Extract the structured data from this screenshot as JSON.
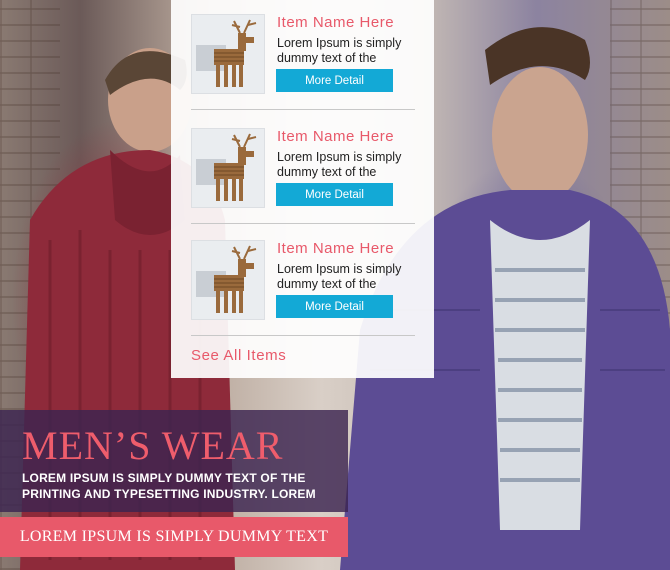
{
  "menu": {
    "items": [
      {
        "name": "Item Name Here",
        "description": "Lorem Ipsum is simply dummy text of the",
        "button": "More Detail",
        "image": "wooden-reindeer-image"
      },
      {
        "name": "Item Name Here",
        "description": "Lorem Ipsum is simply dummy text of the",
        "button": "More Detail",
        "image": "wooden-reindeer-image"
      },
      {
        "name": "Item Name Here",
        "description": "Lorem Ipsum is simply dummy text of the",
        "button": "More Detail",
        "image": "wooden-reindeer-image"
      }
    ],
    "see_all": "See All Items"
  },
  "banner": {
    "title": "MEN’S WEAR",
    "subtitle": "LOREM IPSUM IS SIMPLY DUMMY TEXT OF THE PRINTING AND TYPESETTING INDUSTRY. LOREM",
    "cta": "LOREM IPSUM IS SIMPLY DUMMY TEXT"
  },
  "colors": {
    "accent": "#e8596a",
    "button": "#13a9d6",
    "banner_bg": "#3c2450"
  }
}
